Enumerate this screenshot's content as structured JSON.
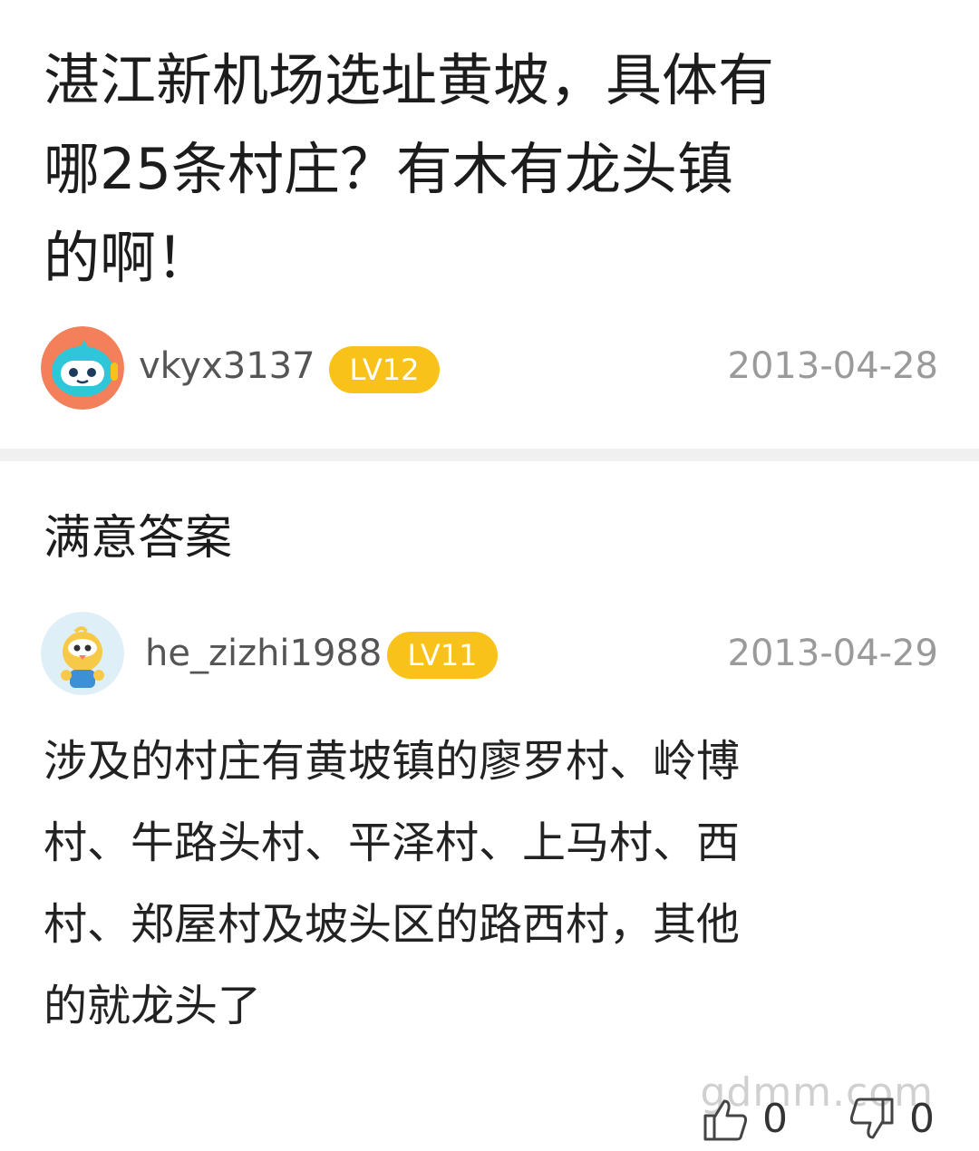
{
  "question": {
    "title": "湛江新机场选址黄坡，具体有哪25条村庄？有木有龙头镇的啊！",
    "username": "vkyx3137",
    "level": "LV12",
    "date": "2013-04-28"
  },
  "answer_section": {
    "heading": "满意答案",
    "username": "he_zizhi1988",
    "level": "LV11",
    "date": "2013-04-29",
    "body": "涉及的村庄有黄坡镇的廖罗村、岭博村、牛路头村、平泽村、上马村、西村、郑屋村及坡头区的路西村，其他的就龙头了",
    "upvotes": "0",
    "downvotes": "0"
  },
  "watermark": "gdmm.com",
  "colors": {
    "badge": "#f9c21b",
    "divider": "#f0f0f0",
    "date": "#9a9a9a"
  },
  "icons": {
    "question_avatar": "robot-avatar-icon",
    "answer_avatar": "chick-avatar-icon",
    "upvote": "thumbs-up-icon",
    "downvote": "thumbs-down-icon"
  }
}
